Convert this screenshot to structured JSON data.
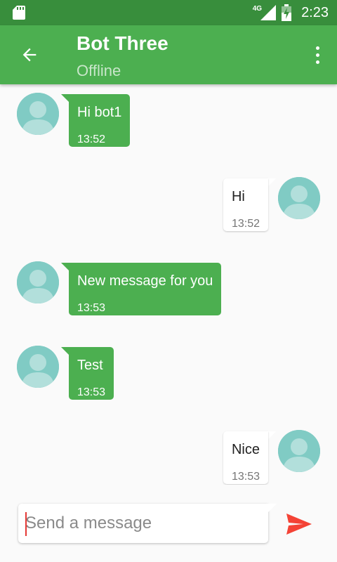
{
  "status_bar": {
    "network": "4G",
    "time": "2:23",
    "icons": [
      "sd-card-icon",
      "signal-icon",
      "battery-icon"
    ]
  },
  "app_bar": {
    "title": "Bot Three",
    "subtitle": "Offline",
    "icons": [
      "back-arrow-icon",
      "more-vert-icon"
    ],
    "color": "#4caf50"
  },
  "messages": [
    {
      "direction": "in",
      "text": "Hi bot1",
      "time": "13:52"
    },
    {
      "direction": "out",
      "text": "Hi",
      "time": "13:52"
    },
    {
      "direction": "in",
      "text": "New message for you",
      "time": "13:53"
    },
    {
      "direction": "in",
      "text": "Test",
      "time": "13:53"
    },
    {
      "direction": "out",
      "text": "Nice",
      "time": "13:53"
    }
  ],
  "composer": {
    "placeholder": "Send a message",
    "value": "",
    "send_icon": "send-icon",
    "send_color": "#f44336"
  }
}
